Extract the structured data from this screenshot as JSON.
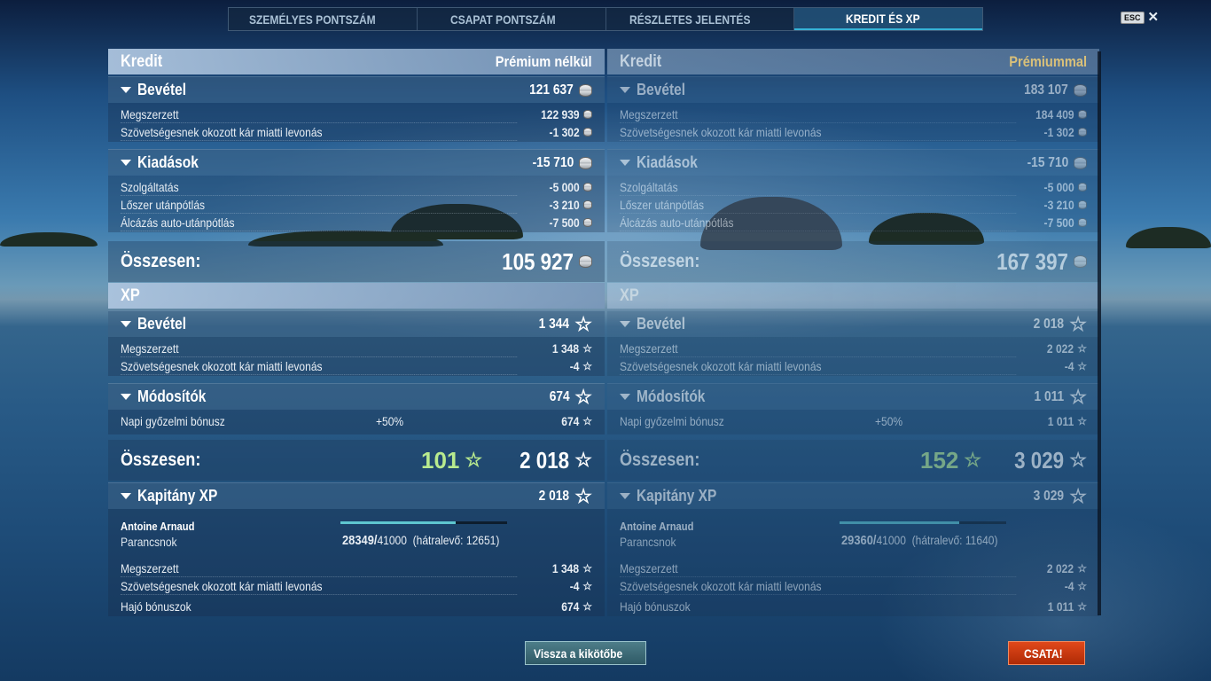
{
  "tabs": [
    {
      "label": "SZEMÉLYES PONTSZÁM",
      "active": false
    },
    {
      "label": "CSAPAT PONTSZÁM",
      "active": false
    },
    {
      "label": "RÉSZLETES JELENTÉS",
      "active": false
    },
    {
      "label": "KREDIT ÉS XP",
      "active": true
    }
  ],
  "esc": {
    "key": "ESC"
  },
  "left": {
    "credit": {
      "title": "Kredit",
      "subtitle": "Prémium nélkül"
    },
    "income": {
      "label": "Bevétel",
      "value": "121 637",
      "earned_label": "Megszerzett",
      "earned": "122 939",
      "penalty_label": "Szövetségesnek okozott kár miatti levonás",
      "penalty": "-1 302"
    },
    "expenses": {
      "label": "Kiadások",
      "value": "-15 710",
      "service_label": "Szolgáltatás",
      "service": "-5 000",
      "ammo_label": "Lőszer utánpótlás",
      "ammo": "-3 210",
      "camo_label": "Álcázás auto-utánpótlás",
      "camo": "-7 500"
    },
    "credit_total": {
      "label": "Összesen:",
      "value": "105 927"
    },
    "xp": {
      "title": "XP"
    },
    "xp_income": {
      "label": "Bevétel",
      "value": "1 344",
      "earned_label": "Megszerzett",
      "earned": "1 348",
      "penalty_label": "Szövetségesnek okozott kár miatti levonás",
      "penalty": "-4"
    },
    "modifiers": {
      "label": "Módosítók",
      "value": "674",
      "daily_label": "Napi győzelmi bónusz",
      "daily_pct": "+50%",
      "daily": "674"
    },
    "xp_total": {
      "label": "Összesen:",
      "free": "101",
      "value": "2 018"
    },
    "captain": {
      "label": "Kapitány XP",
      "value": "2 018",
      "name": "Antoine Arnaud",
      "rank": "Parancsnok",
      "xp_current": "28349/",
      "xp_max": "41000",
      "xp_left": "(hátralevő: 12651)",
      "progress": 0.69,
      "earned_label": "Megszerzett",
      "earned": "1 348",
      "penalty_label": "Szövetségesnek okozott kár miatti levonás",
      "penalty": "-4",
      "ship_label": "Hajó bónuszok",
      "ship": "674"
    }
  },
  "right": {
    "credit": {
      "title": "Kredit",
      "subtitle": "Prémiummal"
    },
    "income": {
      "label": "Bevétel",
      "value": "183 107",
      "earned_label": "Megszerzett",
      "earned": "184 409",
      "penalty_label": "Szövetségesnek okozott kár miatti levonás",
      "penalty": "-1 302"
    },
    "expenses": {
      "label": "Kiadások",
      "value": "-15 710",
      "service_label": "Szolgáltatás",
      "service": "-5 000",
      "ammo_label": "Lőszer utánpótlás",
      "ammo": "-3 210",
      "camo_label": "Álcázás auto-utánpótlás",
      "camo": "-7 500"
    },
    "credit_total": {
      "label": "Összesen:",
      "value": "167 397"
    },
    "xp": {
      "title": "XP"
    },
    "xp_income": {
      "label": "Bevétel",
      "value": "2 018",
      "earned_label": "Megszerzett",
      "earned": "2 022",
      "penalty_label": "Szövetségesnek okozott kár miatti levonás",
      "penalty": "-4"
    },
    "modifiers": {
      "label": "Módosítók",
      "value": "1 011",
      "daily_label": "Napi győzelmi bónusz",
      "daily_pct": "+50%",
      "daily": "1 011"
    },
    "xp_total": {
      "label": "Összesen:",
      "free": "152",
      "value": "3 029"
    },
    "captain": {
      "label": "Kapitány XP",
      "value": "3 029",
      "name": "Antoine Arnaud",
      "rank": "Parancsnok",
      "xp_current": "29360/",
      "xp_max": "41000",
      "xp_left": "(hátralevő: 11640)",
      "progress": 0.72,
      "earned_label": "Megszerzett",
      "earned": "2 022",
      "penalty_label": "Szövetségesnek okozott kár miatti levonás",
      "penalty": "-4",
      "ship_label": "Hajó bónuszok",
      "ship": "1 011"
    }
  },
  "buttons": {
    "port": "Vissza a kikötőbe",
    "battle": "CSATA!"
  }
}
